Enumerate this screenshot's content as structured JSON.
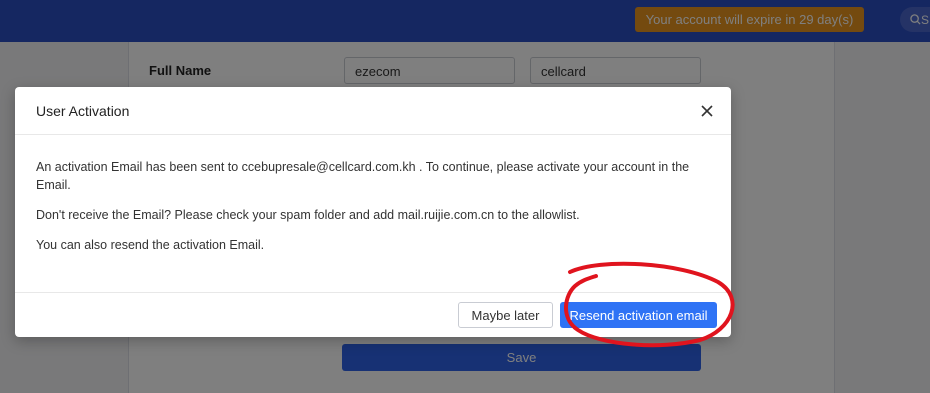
{
  "header": {
    "expire_notice": "Your account will expire in 29 day(s)",
    "search_placeholder": "S"
  },
  "form": {
    "full_name_label": "Full Name",
    "first_name_value": "ezecom",
    "last_name_value": "cellcard",
    "save_label": "Save"
  },
  "modal": {
    "title": "User Activation",
    "close_icon": "close-icon",
    "paragraphs": [
      "An activation Email has been sent to ccebupresale@cellcard.com.kh . To continue, please activate your account in the Email.",
      "Don't receive the Email? Please check your spam folder and add mail.ruijie.com.cn to the allowlist.",
      "You can also resend the activation Email."
    ],
    "maybe_later_label": "Maybe later",
    "resend_label": "Resend activation email"
  },
  "colors": {
    "topbar": "#2b4fc2",
    "expire_badge": "#e8941e",
    "primary": "#2f73f5",
    "annotation": "#e0141e"
  }
}
